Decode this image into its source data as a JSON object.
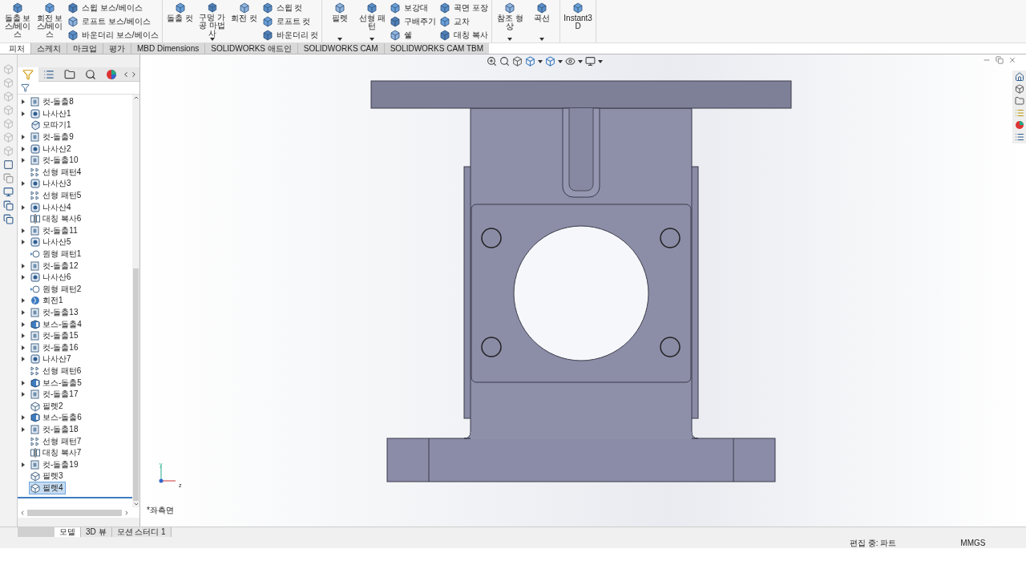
{
  "ribbon": {
    "groups": [
      {
        "columns": [
          {
            "kind": "large",
            "label": "돌출 보스/베이스",
            "dropdown": false
          },
          {
            "kind": "large",
            "label": "회전 보스/베이스",
            "dropdown": false
          },
          {
            "kind": "stack",
            "items": [
              "스윕 보스/베이스",
              "로프트 보스/베이스",
              "바운더리 보스/베이스"
            ]
          }
        ]
      },
      {
        "columns": [
          {
            "kind": "large",
            "label": "돌출 컷",
            "dropdown": false
          },
          {
            "kind": "large",
            "label": "구멍 가공 마법사",
            "dropdown": true
          },
          {
            "kind": "large",
            "label": "회전 컷",
            "dropdown": false
          },
          {
            "kind": "stack",
            "items": [
              "스윕 컷",
              "로프트 컷",
              "바운더리 컷"
            ]
          }
        ]
      },
      {
        "columns": [
          {
            "kind": "large",
            "label": "필렛",
            "dropdown": true
          },
          {
            "kind": "large",
            "label": "선형 패턴",
            "dropdown": true
          },
          {
            "kind": "stack",
            "items": [
              "보강대",
              "구배주기",
              "쉘"
            ]
          },
          {
            "kind": "stack",
            "items": [
              "곡면 포장",
              "교차",
              "대칭 복사"
            ]
          }
        ]
      },
      {
        "columns": [
          {
            "kind": "large",
            "label": "참조 형상",
            "dropdown": true
          },
          {
            "kind": "large",
            "label": "곡선",
            "dropdown": true
          }
        ]
      },
      {
        "columns": [
          {
            "kind": "large",
            "label": "Instant3D",
            "dropdown": false
          }
        ]
      }
    ]
  },
  "tabs": [
    {
      "label": "피처",
      "selected": true
    },
    {
      "label": "스케치",
      "selected": false
    },
    {
      "label": "마크업",
      "selected": false
    },
    {
      "label": "평가",
      "selected": false
    },
    {
      "label": "MBD Dimensions",
      "selected": false
    },
    {
      "label": "SOLIDWORKS 애드인",
      "selected": false
    },
    {
      "label": "SOLIDWORKS CAM",
      "selected": false
    },
    {
      "label": "SOLIDWORKS CAM TBM",
      "selected": false
    }
  ],
  "feature_tree": {
    "items": [
      {
        "label": "컷-돌출8",
        "kind": "cut",
        "expandable": true,
        "selected": false
      },
      {
        "label": "나사산1",
        "kind": "thread",
        "expandable": true,
        "selected": false
      },
      {
        "label": "모따기1",
        "kind": "chamfer",
        "expandable": false,
        "selected": false
      },
      {
        "label": "컷-돌출9",
        "kind": "cut",
        "expandable": true,
        "selected": false
      },
      {
        "label": "나사산2",
        "kind": "thread",
        "expandable": true,
        "selected": false
      },
      {
        "label": "컷-돌출10",
        "kind": "cut",
        "expandable": true,
        "selected": false
      },
      {
        "label": "선형 패턴4",
        "kind": "pattern",
        "expandable": false,
        "selected": false
      },
      {
        "label": "나사산3",
        "kind": "thread",
        "expandable": true,
        "selected": false
      },
      {
        "label": "선형 패턴5",
        "kind": "pattern",
        "expandable": false,
        "selected": false
      },
      {
        "label": "나사산4",
        "kind": "thread",
        "expandable": true,
        "selected": false
      },
      {
        "label": "대칭 복사6",
        "kind": "mirror",
        "expandable": false,
        "selected": false
      },
      {
        "label": "컷-돌출11",
        "kind": "cut",
        "expandable": true,
        "selected": false
      },
      {
        "label": "나사산5",
        "kind": "thread",
        "expandable": true,
        "selected": false
      },
      {
        "label": "원형 패턴1",
        "kind": "circular",
        "expandable": false,
        "selected": false
      },
      {
        "label": "컷-돌출12",
        "kind": "cut",
        "expandable": true,
        "selected": false
      },
      {
        "label": "나사산6",
        "kind": "thread",
        "expandable": true,
        "selected": false
      },
      {
        "label": "원형 패턴2",
        "kind": "circular",
        "expandable": false,
        "selected": false
      },
      {
        "label": "회전1",
        "kind": "revolve",
        "expandable": true,
        "selected": false
      },
      {
        "label": "컷-돌출13",
        "kind": "cut",
        "expandable": true,
        "selected": false
      },
      {
        "label": "보스-돌출4",
        "kind": "boss",
        "expandable": true,
        "selected": false
      },
      {
        "label": "컷-돌출15",
        "kind": "cut",
        "expandable": true,
        "selected": false
      },
      {
        "label": "컷-돌출16",
        "kind": "cut",
        "expandable": true,
        "selected": false
      },
      {
        "label": "나사산7",
        "kind": "thread",
        "expandable": true,
        "selected": false
      },
      {
        "label": "선형 패턴6",
        "kind": "pattern",
        "expandable": false,
        "selected": false
      },
      {
        "label": "보스-돌출5",
        "kind": "boss",
        "expandable": true,
        "selected": false
      },
      {
        "label": "컷-돌출17",
        "kind": "cut",
        "expandable": true,
        "selected": false
      },
      {
        "label": "필렛2",
        "kind": "fillet",
        "expandable": false,
        "selected": false
      },
      {
        "label": "보스-돌출6",
        "kind": "boss",
        "expandable": true,
        "selected": false
      },
      {
        "label": "컷-돌출18",
        "kind": "cut",
        "expandable": true,
        "selected": false
      },
      {
        "label": "선형 패턴7",
        "kind": "pattern",
        "expandable": false,
        "selected": false
      },
      {
        "label": "대칭 복사7",
        "kind": "mirror",
        "expandable": false,
        "selected": false
      },
      {
        "label": "컷-돌출19",
        "kind": "cut",
        "expandable": true,
        "selected": false
      },
      {
        "label": "필렛3",
        "kind": "fillet",
        "expandable": false,
        "selected": false
      },
      {
        "label": "필렛4",
        "kind": "fillet",
        "expandable": false,
        "selected": true
      }
    ]
  },
  "viewport": {
    "view_name": "*좌측면",
    "triad": {
      "y_label": "y",
      "z_label": "z"
    }
  },
  "bottom_tabs": [
    {
      "label": "모델",
      "selected": true
    },
    {
      "label": "3D 뷰",
      "selected": false
    },
    {
      "label": "모션 스터디 1",
      "selected": false
    }
  ],
  "status_bar": {
    "mode": "편집 중: 파트",
    "units": "MMGS"
  }
}
